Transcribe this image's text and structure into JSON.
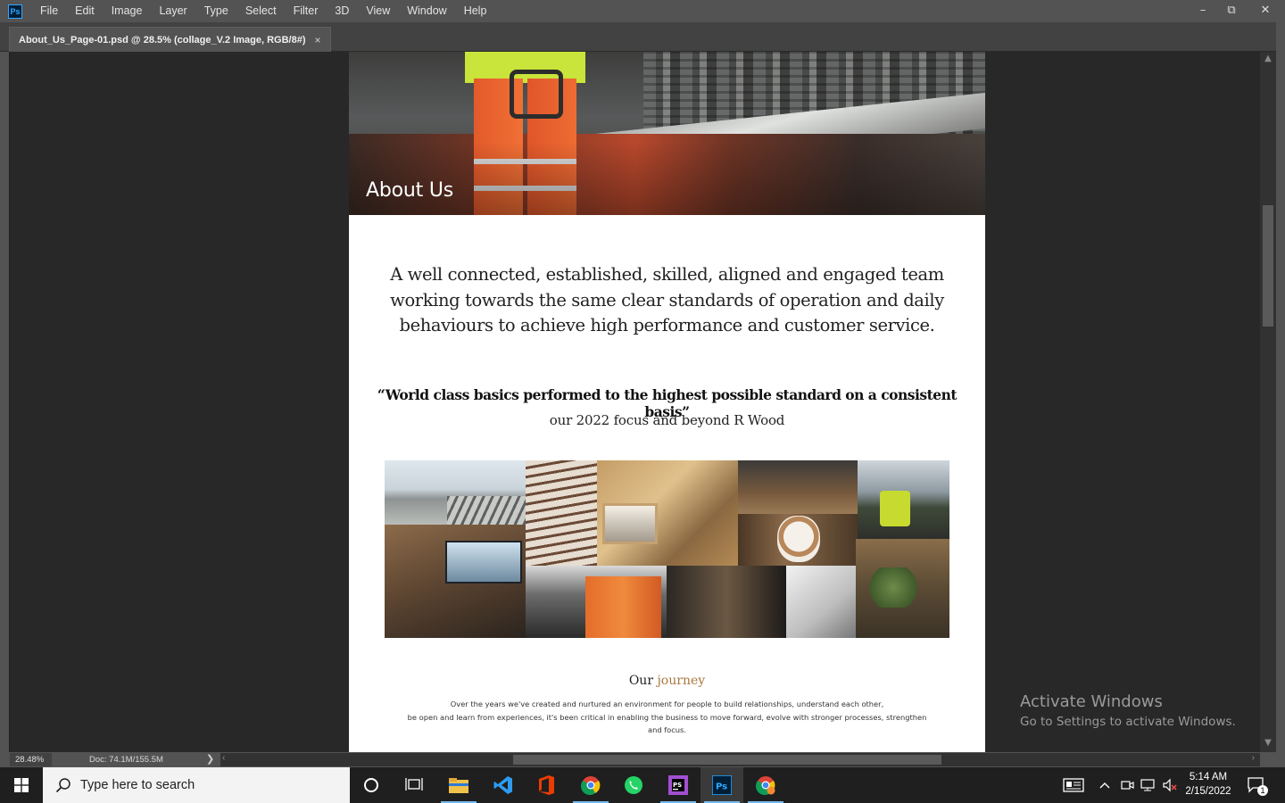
{
  "app": {
    "logo_text": "Ps",
    "menu": [
      "File",
      "Edit",
      "Image",
      "Layer",
      "Type",
      "Select",
      "Filter",
      "3D",
      "View",
      "Window",
      "Help"
    ],
    "window_controls": {
      "minimize": "–",
      "restore": "⧉",
      "close": "✕"
    }
  },
  "document_tab": {
    "title": "About_Us_Page-01.psd @ 28.5% (collage_V.2 Image, RGB/8#)",
    "close": "×"
  },
  "page": {
    "hero_title": "About Us",
    "intro_lines": [
      "A well connected, established, skilled, aligned and engaged team",
      "working towards the same clear standards of operation and daily",
      "behaviours to achieve high performance and customer service."
    ],
    "quote": "“World class basics performed to the highest possible standard on a consistent basis”",
    "quote_attribution": "our 2022 focus and beyond R Wood",
    "journey_title_a": "Our ",
    "journey_title_b": "journey",
    "journey_lines": [
      "Over the years we've created and nurtured an environment for people to build relationships, understand each other,",
      "be open and learn from experiences, it's been critical in enabling the business to move forward, evolve with stronger processes, strengthen",
      "and focus."
    ]
  },
  "status": {
    "zoom": "28.48%",
    "doc_info": "Doc: 74.1M/155.5M",
    "arrow": "❯"
  },
  "activation": {
    "title": "Activate Windows",
    "subtitle": "Go to Settings to activate Windows."
  },
  "taskbar": {
    "search_placeholder": "Type here to search",
    "time": "5:14 AM",
    "date": "2/15/2022",
    "notification_count": "1"
  },
  "colors": {
    "ps_chrome": "#535353",
    "workspace": "#282828",
    "ps_blue": "#31a8ff",
    "accent_gold": "#a9773e"
  }
}
